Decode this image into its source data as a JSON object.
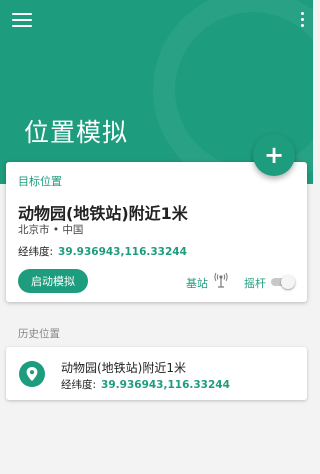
{
  "header": {
    "title": "位置模拟",
    "menu_icon": "menu-icon",
    "more_icon": "more-vert-icon",
    "color": "#1e9c7e"
  },
  "fab": {
    "label": "+"
  },
  "target": {
    "section_label": "目标位置",
    "name": "动物园(地铁站)附近1米",
    "city": "北京市 • 中国",
    "coords_label": "经纬度:",
    "coords_value": "39.936943,116.33244",
    "start_button": "启动模拟",
    "station_label": "基站",
    "station_icon": "antenna-icon",
    "joystick_label": "摇杆",
    "joystick_on": false
  },
  "history": {
    "title": "历史位置",
    "items": [
      {
        "name": "动物园(地铁站)附近1米",
        "coords_label": "经纬度:",
        "coords_value": "39.936943,116.33244",
        "icon": "location-pin-icon"
      }
    ]
  }
}
